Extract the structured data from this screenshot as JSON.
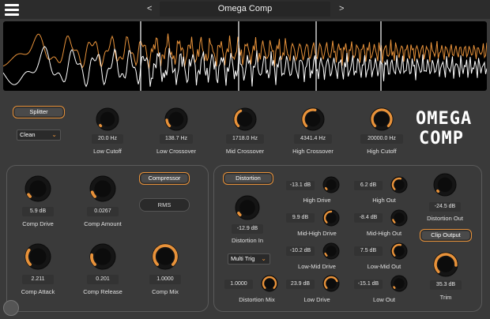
{
  "header": {
    "preset_name": "Omega Comp",
    "prev_arrow": "<",
    "next_arrow": ">"
  },
  "logo": {
    "line1": "OMEGA",
    "line2": "COMP"
  },
  "splitter": {
    "button": "Splitter",
    "mode": "Clean",
    "knobs": [
      {
        "key": "low_cutoff",
        "label": "Low Cutoff",
        "value": "20.0 Hz",
        "level": 0.02
      },
      {
        "key": "low_crossover",
        "label": "Low Crossover",
        "value": "138.7 Hz",
        "level": 0.15
      },
      {
        "key": "mid_crossover",
        "label": "Mid Crossover",
        "value": "1718.0 Hz",
        "level": 0.4
      },
      {
        "key": "high_crossover",
        "label": "High Crossover",
        "value": "4341.4 Hz",
        "level": 0.55
      },
      {
        "key": "high_cutoff",
        "label": "High Cutoff",
        "value": "20000.0 Hz",
        "level": 1.0
      }
    ]
  },
  "compressor": {
    "button": "Compressor",
    "rms": "RMS",
    "knobs": [
      {
        "key": "comp_drive",
        "label": "Comp Drive",
        "value": "5.9 dB",
        "level": 0.05
      },
      {
        "key": "comp_amount",
        "label": "Comp Amount",
        "value": "0.0267",
        "level": 0.1
      },
      {
        "key": "comp_attack",
        "label": "Comp Attack",
        "value": "2.211",
        "level": 0.3
      },
      {
        "key": "comp_release",
        "label": "Comp Release",
        "value": "0.201",
        "level": 0.2
      },
      {
        "key": "comp_mix",
        "label": "Comp Mix",
        "value": "1.0000",
        "level": 1.0
      }
    ]
  },
  "distortion": {
    "button": "Distortion",
    "mode": "Multi Trig",
    "clip_output": "Clip Output",
    "knobs": [
      {
        "key": "distortion_in",
        "label": "Distortion In",
        "value": "-12.9 dB",
        "level": 0.05
      },
      {
        "key": "distortion_mix",
        "label": "Distortion Mix",
        "value": "1.0000",
        "level": 1.0
      },
      {
        "key": "high_drive",
        "label": "High Drive",
        "value": "-13.1 dB",
        "level": 0.05
      },
      {
        "key": "mid_high_drive",
        "label": "Mid-High Drive",
        "value": "9.9 dB",
        "level": 0.5
      },
      {
        "key": "low_mid_drive",
        "label": "Low-Mid Drive",
        "value": "-10.2 dB",
        "level": 0.08
      },
      {
        "key": "low_drive",
        "label": "Low Drive",
        "value": "23.9 dB",
        "level": 0.75
      },
      {
        "key": "high_out",
        "label": "High Out",
        "value": "6.2 dB",
        "level": 0.55
      },
      {
        "key": "mid_high_out",
        "label": "Mid-High Out",
        "value": "-8.4 dB",
        "level": 0.1
      },
      {
        "key": "low_mid_out",
        "label": "Low-Mid Out",
        "value": "7.5 dB",
        "level": 0.55
      },
      {
        "key": "low_out",
        "label": "Low Out",
        "value": "-15.1 dB",
        "level": 0.04
      },
      {
        "key": "distortion_out",
        "label": "Distortion Out",
        "value": "-24.5 dB",
        "level": 0.02
      },
      {
        "key": "trim",
        "label": "Trim",
        "value": "35.3 dB",
        "level": 0.85
      }
    ]
  },
  "colors": {
    "accent": "#e8923a",
    "background": "#3a3a3a",
    "scope_input": "#ffffff",
    "scope_output": "#e8923a"
  }
}
